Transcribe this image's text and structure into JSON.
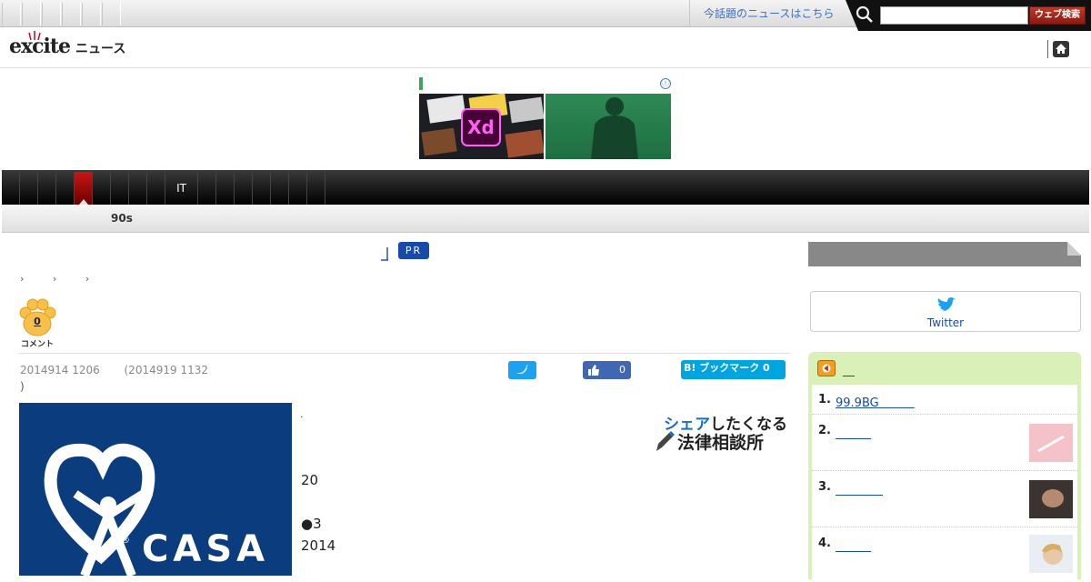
{
  "topbar": {
    "trending_link": "今話題のニュースはこちら",
    "search_placeholder": "",
    "search_button": "ウェブ検索"
  },
  "header": {
    "logo_text": "excite",
    "logo_news": "ニュース"
  },
  "ad": {
    "xd_label": "Xd",
    "info_icon": "ⓘ"
  },
  "category_nav": {
    "items": [
      "",
      "",
      "",
      "",
      "",
      "",
      "",
      "",
      "",
      "IT",
      "",
      "",
      "",
      "",
      "",
      "",
      "",
      ""
    ],
    "active_index": 4
  },
  "subnav": {
    "label": "90s"
  },
  "article": {
    "pr_badge": "PR",
    "breadcrumb": "› › ›",
    "comment_count": "0",
    "comment_label": "コメント",
    "published": "2014914 1206",
    "updated": "(2014919 1132",
    "updated_close": ")",
    "facebook_count": "0",
    "hatena_label": "B! ブックマーク 0",
    "hero_brand": "CASA",
    "body_dot": "·",
    "body_lines": [
      "20",
      "",
      "●3",
      "2014"
    ],
    "law_banner_line1_blue": "シェア",
    "law_banner_line1_rest": "したくなる",
    "law_banner_line2": "法律相談所"
  },
  "sidebar": {
    "twitter_label": "Twitter",
    "ranking_head_link": "＿",
    "ranking": [
      {
        "num": "1.",
        "title": "99.9BG　　　"
      },
      {
        "num": "2.",
        "title": "＿＿＿"
      },
      {
        "num": "3.",
        "title": "＿＿＿＿"
      },
      {
        "num": "4.",
        "title": "＿＿＿"
      }
    ]
  },
  "colors": {
    "accent_red": "#c81616",
    "link_blue": "#1a4aa8",
    "twitter": "#1da1f2",
    "facebook": "#4267b2",
    "hatena": "#00a4de",
    "ranking_bg": "#d9f0b8"
  }
}
